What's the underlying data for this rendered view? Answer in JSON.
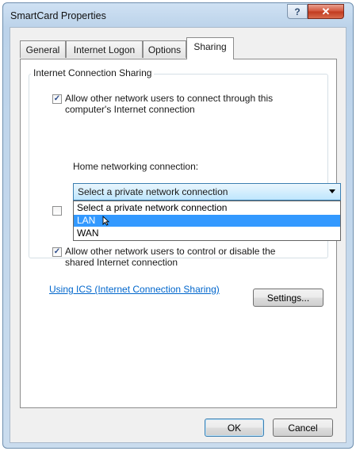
{
  "window": {
    "title": "SmartCard Properties",
    "help_label": "?",
    "close_label": "✕"
  },
  "tabs": [
    {
      "label": "General"
    },
    {
      "label": "Internet Logon"
    },
    {
      "label": "Options"
    },
    {
      "label": "Sharing",
      "active": true
    }
  ],
  "sharing": {
    "group_title": "Internet Connection Sharing",
    "allow_connect": {
      "checked": true,
      "line1": "Allow other network users to connect through this",
      "line2": "computer's Internet connection"
    },
    "home_label": "Home networking connection:",
    "home_select": {
      "value": "Select a private network connection",
      "options": [
        "Select a private network connection",
        "LAN",
        "WAN"
      ],
      "highlighted": "LAN"
    },
    "hidden_checkbox_checked": false,
    "allow_control": {
      "checked": true,
      "line1": "Allow other network users to control or disable the",
      "line2": "shared Internet connection"
    },
    "ics_link": "Using ICS (Internet Connection Sharing)",
    "settings_button": "Settings..."
  },
  "footer": {
    "ok_label": "OK",
    "cancel_label": "Cancel"
  },
  "colors": {
    "selection": "#3399ff",
    "link": "#0066cc",
    "close_button": "#c13a1f"
  }
}
